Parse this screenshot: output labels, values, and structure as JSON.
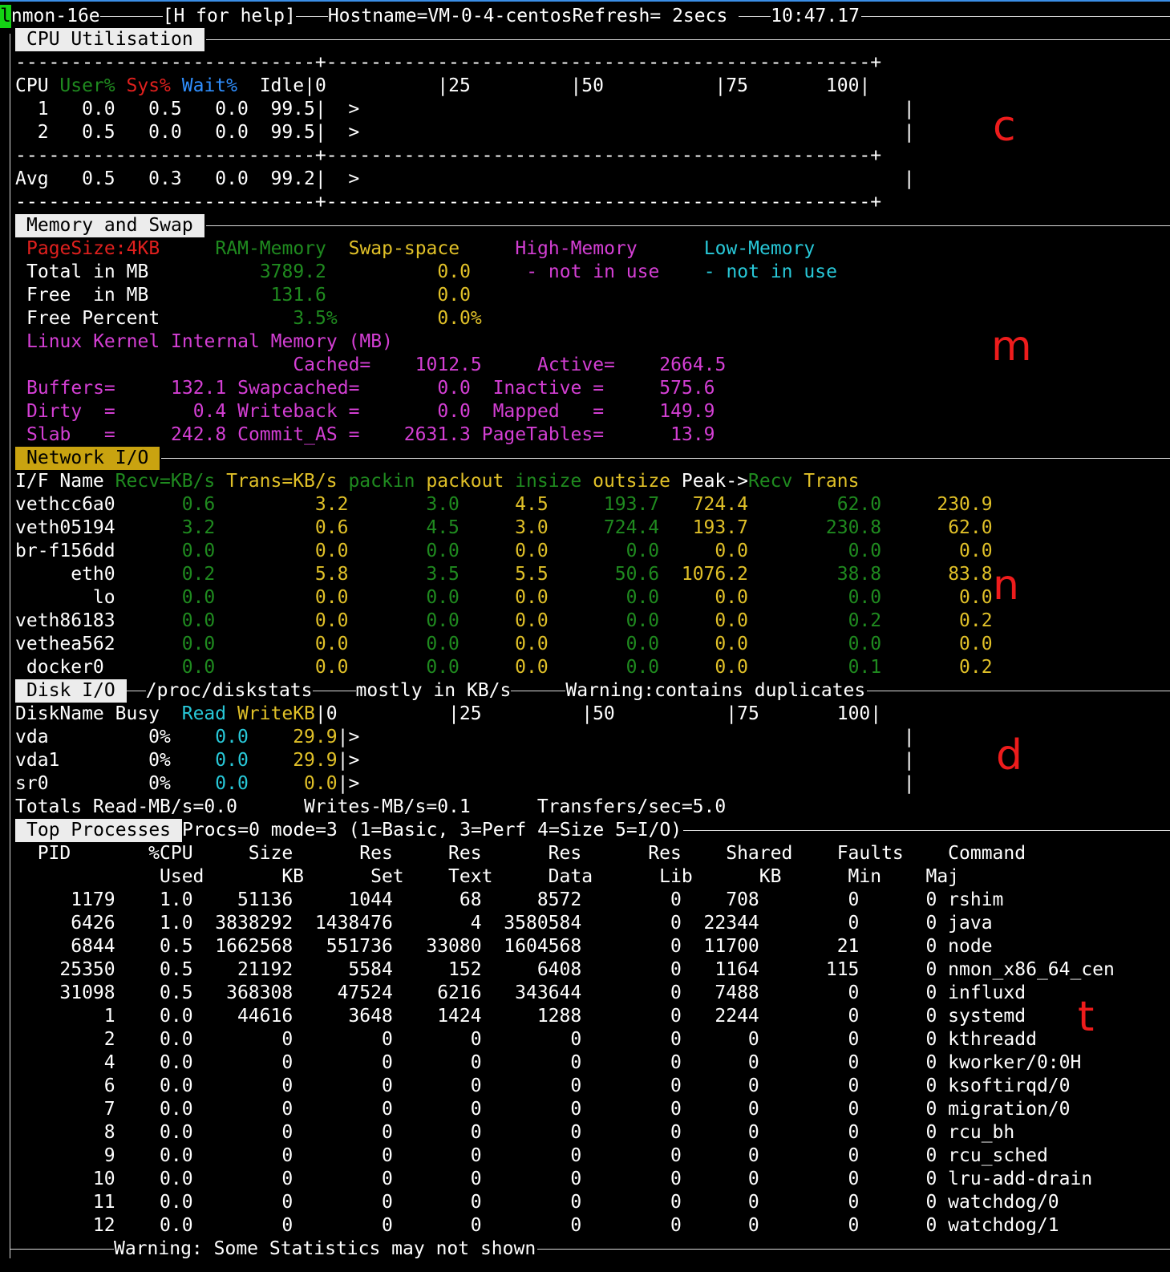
{
  "header": {
    "cursor": "l",
    "app": "nmon-16e",
    "help": "[H for help]",
    "host": "Hostname=VM-0-4-centosRefresh= 2secs ",
    "time": "10:47.17"
  },
  "cpu": {
    "title": "CPU Utilisation",
    "dash_line": "---------------------------+-------------------------------------------------+",
    "header": {
      "cpu": "CPU",
      "user": "User%",
      "sys": "Sys%",
      "wait": "Wait%",
      "scale": "  Idle|0          |25         |50          |75       100|"
    },
    "rows": [
      {
        "label": "  1",
        "vals": "   0.0   0.5   0.0  99.5|  >                                                 |"
      },
      {
        "label": "  2",
        "vals": "   0.5   0.0   0.0  99.5|  >                                                 |"
      }
    ],
    "avg": {
      "label": "Avg",
      "vals": "   0.5   0.3   0.0  99.2|  >                                                 |"
    }
  },
  "memory": {
    "title": "Memory and Swap",
    "pagesize": "PageSize:4KB",
    "col_ram": "RAM-Memory",
    "col_swap": "Swap-space",
    "col_high": "High-Memory",
    "col_low": "Low-Memory",
    "total_label": "Total in MB",
    "total_ram": "3789.2",
    "total_swap": "0.0",
    "high_status": "- not in use",
    "low_status": "- not in use",
    "free_label": "Free  in MB",
    "free_ram": "131.6",
    "free_swap": "0.0",
    "freepct_label": "Free Percent",
    "freepct_ram": "3.5%",
    "freepct_swap": "0.0%",
    "kernel_title": "Linux Kernel Internal Memory (MB)",
    "kernel_lines": [
      "                        Cached=    1012.5     Active=    2664.5",
      "Buffers=     132.1 Swapcached=       0.0  Inactive =     575.6",
      "Dirty  =       0.4 Writeback =       0.0  Mapped   =     149.9",
      "Slab   =     242.8 Commit_AS =    2631.3 PageTables=      13.9"
    ]
  },
  "network": {
    "title": "Network I/O",
    "header": {
      "ifname": "I/F Name ",
      "recv": "Recv=KB/s ",
      "trans": "Trans=KB/s ",
      "packin": "packin ",
      "packout": "packout ",
      "insize": "insize ",
      "outsize": "outsize ",
      "peak": "Peak->",
      "peakrecv": "Recv ",
      "peaktrans": "Trans"
    },
    "rows": [
      {
        "name": "vethcc6a0",
        "recv": "      0.6",
        "trans": "         3.2",
        "packin": "       3.0",
        "packout": "     4.5",
        "insize": "     193.7",
        "outsize": "   724.4",
        "precv": "        62.0",
        "ptrans": "     230.9"
      },
      {
        "name": "veth05194",
        "recv": "      3.2",
        "trans": "         0.6",
        "packin": "       4.5",
        "packout": "     3.0",
        "insize": "     724.4",
        "outsize": "   193.7",
        "precv": "       230.8",
        "ptrans": "      62.0"
      },
      {
        "name": "br-f156dd",
        "recv": "      0.0",
        "trans": "         0.0",
        "packin": "       0.0",
        "packout": "     0.0",
        "insize": "       0.0",
        "outsize": "     0.0",
        "precv": "         0.0",
        "ptrans": "       0.0"
      },
      {
        "name": "     eth0",
        "recv": "      0.2",
        "trans": "         5.8",
        "packin": "       3.5",
        "packout": "     5.5",
        "insize": "      50.6",
        "outsize": "  1076.2",
        "precv": "        38.8",
        "ptrans": "      83.8"
      },
      {
        "name": "       lo",
        "recv": "      0.0",
        "trans": "         0.0",
        "packin": "       0.0",
        "packout": "     0.0",
        "insize": "       0.0",
        "outsize": "     0.0",
        "precv": "         0.0",
        "ptrans": "       0.0"
      },
      {
        "name": "veth86183",
        "recv": "      0.0",
        "trans": "         0.0",
        "packin": "       0.0",
        "packout": "     0.0",
        "insize": "       0.0",
        "outsize": "     0.0",
        "precv": "         0.2",
        "ptrans": "       0.2"
      },
      {
        "name": "vethea562",
        "recv": "      0.0",
        "trans": "         0.0",
        "packin": "       0.0",
        "packout": "     0.0",
        "insize": "       0.0",
        "outsize": "     0.0",
        "precv": "         0.0",
        "ptrans": "       0.0"
      },
      {
        "name": " docker0 ",
        "recv": "      0.0",
        "trans": "         0.0",
        "packin": "       0.0",
        "packout": "     0.0",
        "insize": "       0.0",
        "outsize": "     0.0",
        "precv": "         0.1",
        "ptrans": "       0.2"
      }
    ]
  },
  "disk": {
    "title": "Disk I/O",
    "procfile": "/proc/diskstats",
    "unit": "mostly in KB/s",
    "warning": "Warning:contains duplicates",
    "header": {
      "name": "DiskName Busy  ",
      "read": "Read ",
      "write": "WriteKB",
      "scale": "|0          |25         |50          |75       100|"
    },
    "rows": [
      {
        "name": "vda         0%  ",
        "read": "  0.0",
        "write": "    29.9",
        "bar": "|>                                                 |"
      },
      {
        "name": "vda1        0%  ",
        "read": "  0.0",
        "write": "    29.9",
        "bar": "|>                                                 |"
      },
      {
        "name": "sr0         0%  ",
        "read": "  0.0",
        "write": "     0.0",
        "bar": "|>                                                 |"
      }
    ],
    "totals": "Totals Read-MB/s=0.0      Writes-MB/s=0.1      Transfers/sec=5.0"
  },
  "top": {
    "title": "Top Processes",
    "mode_info": "Procs=0 mode=3 (1=Basic, 3=Perf 4=Size 5=I/O)",
    "header1": "  PID       %CPU     Size      Res     Res      Res      Res    Shared    Faults    Command",
    "header2": "             Used       KB      Set    Text     Data      Lib      KB      Min    Maj",
    "rows": [
      "     1179    1.0    51136     1044      68     8572        0    708        0      0 rshim",
      "     6426    1.0  3838292  1438476       4  3580584        0  22344        0      0 java",
      "     6844    0.5  1662568   551736   33080  1604568        0  11700       21      0 node",
      "    25350    0.5    21192     5584     152     6408        0   1164      115      0 nmon_x86_64_cen",
      "    31098    0.5   368308    47524    6216   343644        0   7488        0      0 influxd",
      "        1    0.0    44616     3648    1424     1288        0   2244        0      0 systemd",
      "        2    0.0        0        0       0        0        0      0        0      0 kthreadd",
      "        4    0.0        0        0       0        0        0      0        0      0 kworker/0:0H",
      "        6    0.0        0        0       0        0        0      0        0      0 ksoftirqd/0",
      "        7    0.0        0        0       0        0        0      0        0      0 migration/0",
      "        8    0.0        0        0       0        0        0      0        0      0 rcu_bh",
      "        9    0.0        0        0       0        0        0      0        0      0 rcu_sched",
      "       10    0.0        0        0       0        0        0      0        0      0 lru-add-drain",
      "       11    0.0        0        0       0        0        0      0        0      0 watchdog/0",
      "       12    0.0        0        0       0        0        0      0        0      0 watchdog/1"
    ],
    "footer": "Warning: Some Statistics may not shown"
  },
  "annotations": {
    "cpu": "c",
    "memory": "m",
    "network": "n",
    "disk": "d",
    "top": "t"
  },
  "colors": {
    "green": "#1f8a1f",
    "red": "#e0201e",
    "blue": "#2f8fff",
    "yellow": "#e0c028",
    "magenta": "#d43fd4",
    "cyan": "#28c8d8",
    "annotation": "#ee1c1c"
  }
}
